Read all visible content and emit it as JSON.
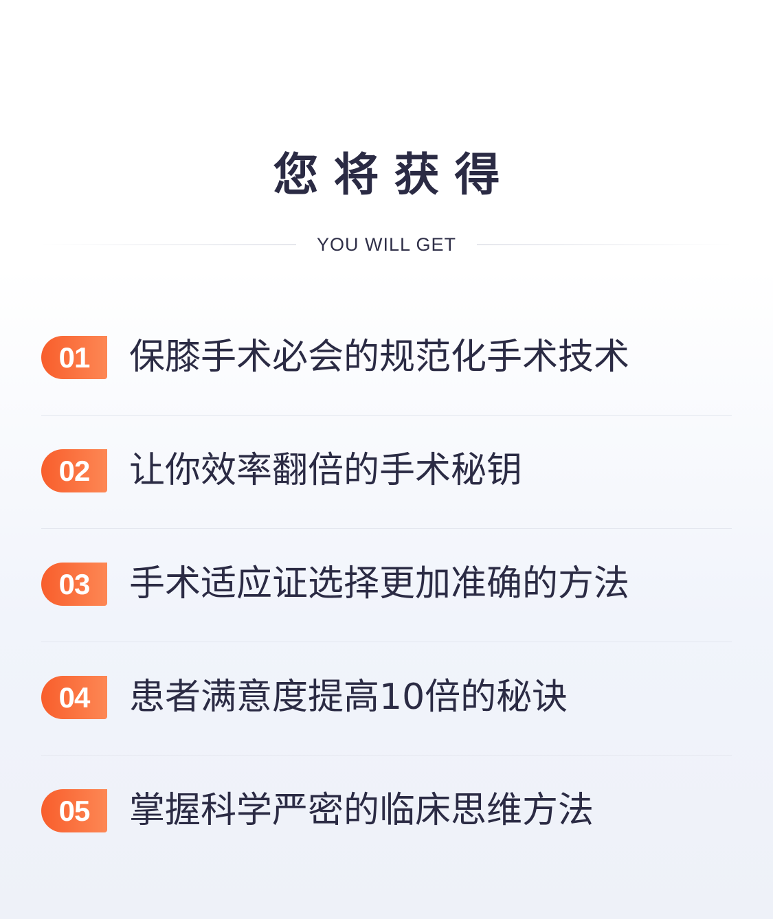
{
  "header": {
    "title": "您将获得",
    "subtitle": "YOU WILL GET"
  },
  "items": [
    {
      "number": "01",
      "text": "保膝手术必会的规范化手术技术"
    },
    {
      "number": "02",
      "text": "让你效率翻倍的手术秘钥"
    },
    {
      "number": "03",
      "text": "手术适应证选择更加准确的方法"
    },
    {
      "number": "04",
      "text": "患者满意度提高10倍的秘诀"
    },
    {
      "number": "05",
      "text": "掌握科学严密的临床思维方法"
    }
  ],
  "colors": {
    "accent_start": "#f85e2c",
    "accent_end": "#fd8754",
    "text": "#2b2b44",
    "background_bottom": "#eef1f8"
  }
}
